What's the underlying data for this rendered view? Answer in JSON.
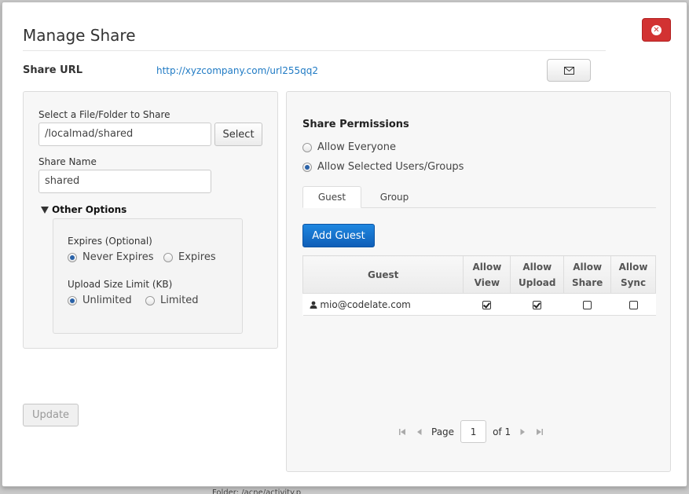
{
  "background": {
    "behind_text": "Folder: /acne/activity.p"
  },
  "dialog": {
    "title": "Manage Share",
    "share_url_label": "Share URL",
    "share_url": "http://xyzcompany.com/url255qq2",
    "icons": {
      "close": "close-circle-icon",
      "mail": "envelope-icon"
    }
  },
  "left": {
    "file_label": "Select a File/Folder to Share",
    "file_value": "/localmad/shared",
    "select_label": "Select",
    "share_name_label": "Share Name",
    "share_name_value": "shared",
    "other_options_label": "Other Options",
    "expires_label": "Expires (Optional)",
    "expires_options": [
      "Never Expires",
      "Expires"
    ],
    "upload_limit_label": "Upload Size Limit (KB)",
    "upload_options": [
      "Unlimited",
      "Limited"
    ],
    "update_label": "Update"
  },
  "right": {
    "permissions_label": "Share Permissions",
    "allow_options": [
      "Allow Everyone",
      "Allow Selected Users/Groups"
    ],
    "tabs": [
      "Guest",
      "Group"
    ],
    "add_guest_label": "Add Guest",
    "table": {
      "headers": [
        "Guest",
        "Allow View",
        "Allow Upload",
        "Allow Share",
        "Allow Sync"
      ],
      "rows": [
        {
          "user": "mio@codelate.com",
          "allow_view": true,
          "allow_upload": true,
          "allow_share": false,
          "allow_sync": false
        }
      ]
    },
    "pager": {
      "page_label": "Page",
      "page_value": "1",
      "of_label": "of 1"
    }
  },
  "colors": {
    "primary": "#1576d2",
    "danger": "#d23232",
    "link": "#1f7ac4"
  }
}
